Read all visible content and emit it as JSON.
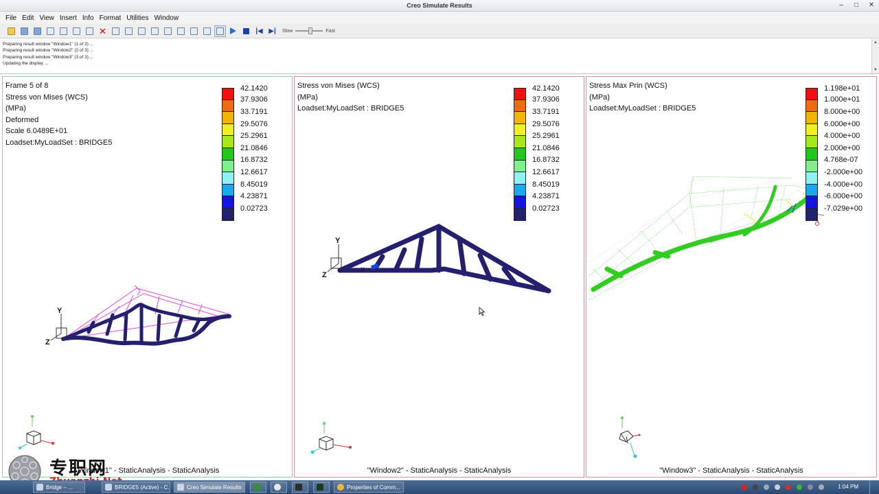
{
  "window": {
    "title": "Creo Simulate Results",
    "controls": [
      "–",
      "□",
      "✕"
    ]
  },
  "menu": [
    "File",
    "Edit",
    "View",
    "Insert",
    "Info",
    "Format",
    "Utilities",
    "Window"
  ],
  "toolbar": {
    "icons": [
      "open-icon",
      "save-icon",
      "save-as-icon",
      "print-icon",
      "page-setup-icon",
      "copy-icon",
      "copy-window-icon",
      "delete-icon",
      "import-icon",
      "export-icon",
      "edit-definition-icon",
      "zoom-in-icon",
      "zoom-out-icon",
      "refit-icon",
      "spin-icon",
      "orient-icon",
      "animate-icon",
      "play-icon",
      "stop-icon",
      "first-frame-icon",
      "last-frame-icon"
    ],
    "speed_slow": "Slow",
    "speed_fast": "Fast",
    "speed_level": 0.55
  },
  "messages": [
    "Preparing result window \"Window1\" (1 of 3) ...",
    "Preparing result window \"Window2\" (2 of 3) ...",
    "Preparing result window \"Window3\" (3 of 3) ...",
    "Updating the display ..."
  ],
  "panes": [
    {
      "info": [
        "Frame 5 of 8",
        "Stress von Mises (WCS)",
        "(MPa)",
        "Deformed",
        "Scale  6.0489E+01",
        "Loadset:MyLoadSet  :  BRIDGE5"
      ],
      "legend": [
        "42.1420",
        "37.9306",
        "33.7191",
        "29.5076",
        "25.2961",
        "21.0846",
        "16.8732",
        "12.6617",
        "8.45019",
        "4.23871",
        "0.02723"
      ],
      "label": "\"Window1\" - StaticAnalysis - StaticAnalysis"
    },
    {
      "info": [
        "Stress von Mises (WCS)",
        "(MPa)",
        "Loadset:MyLoadSet  :  BRIDGE5"
      ],
      "legend": [
        "42.1420",
        "37.9306",
        "33.7191",
        "29.5076",
        "25.2961",
        "21.0846",
        "16.8732",
        "12.6617",
        "8.45019",
        "4.23871",
        "0.02723"
      ],
      "label": "\"Window2\" - StaticAnalysis - StaticAnalysis"
    },
    {
      "info": [
        "Stress Max Prin (WCS)",
        "(MPa)",
        "Loadset:MyLoadSet  :  BRIDGE5"
      ],
      "legend": [
        "1.198e+01",
        "1.000e+01",
        "8.000e+00",
        "6.000e+00",
        "4.000e+00",
        "2.000e+00",
        "4.768e-07",
        "-2.000e+00",
        "-4.000e+00",
        "-6.000e+00",
        "-7.029e+00"
      ],
      "label": "\"Window3\" - StaticAnalysis - StaticAnalysis"
    }
  ],
  "legend_colors": [
    "#ee1111",
    "#f06a10",
    "#f3b40a",
    "#f0f020",
    "#a6e81a",
    "#22c81e",
    "#7ef28a",
    "#8ef2f2",
    "#1aa8f0",
    "#1515e0",
    "#22226e"
  ],
  "axes": {
    "y": "Y",
    "z": "Z",
    "x": "X"
  },
  "watermark": {
    "cn": "专职网",
    "url": "Zhuanzhi.Net"
  },
  "taskbar": {
    "items": [
      "Bridge – ...",
      "BRIDGE5 (Active) - C...",
      "Creo Simulate Results",
      "",
      "",
      "",
      "Properties of Comm..."
    ],
    "clock": "1:04 PM"
  }
}
